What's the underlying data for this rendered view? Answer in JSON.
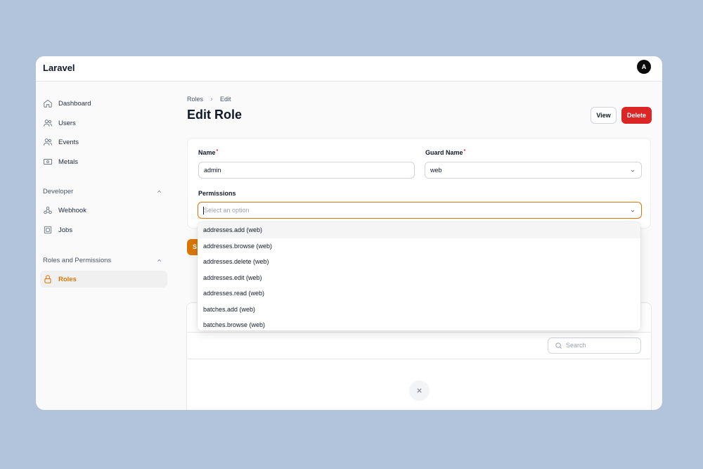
{
  "app": {
    "brand": "Laravel",
    "avatar_initial": "A"
  },
  "sidebar": {
    "items": [
      {
        "label": "Dashboard",
        "icon": "home-icon"
      },
      {
        "label": "Users",
        "icon": "users-icon"
      },
      {
        "label": "Events",
        "icon": "users-icon"
      },
      {
        "label": "Metals",
        "icon": "banknote-icon"
      }
    ],
    "groups": [
      {
        "label": "Developer",
        "items": [
          {
            "label": "Webhook",
            "icon": "webhook-icon"
          },
          {
            "label": "Jobs",
            "icon": "cpu-icon"
          }
        ]
      },
      {
        "label": "Roles and Permissions",
        "items": [
          {
            "label": "Roles",
            "icon": "lock-icon",
            "active": true
          }
        ]
      }
    ]
  },
  "breadcrumb": {
    "parent": "Roles",
    "current": "Edit"
  },
  "page": {
    "title": "Edit Role"
  },
  "header_actions": {
    "view_label": "View",
    "delete_label": "Delete"
  },
  "form": {
    "name_label": "Name",
    "name_value": "admin",
    "guard_label": "Guard Name",
    "guard_value": "web",
    "permissions_label": "Permissions",
    "permissions_placeholder": "Select an option",
    "required_mark": "*"
  },
  "permissions_options": [
    "addresses.add (web)",
    "addresses.browse (web)",
    "addresses.delete (web)",
    "addresses.edit (web)",
    "addresses.read (web)",
    "batches.add (web)",
    "batches.browse (web)"
  ],
  "save_button_label": "S",
  "relation": {
    "search_placeholder": "Search"
  },
  "colors": {
    "accent": "#d97706",
    "danger": "#dc2626",
    "background": "#b2c3dc"
  }
}
